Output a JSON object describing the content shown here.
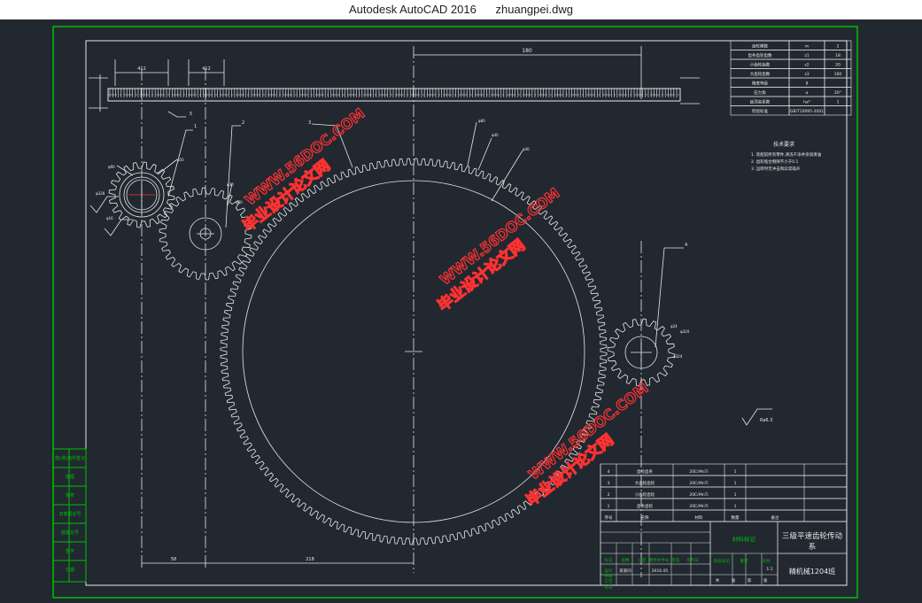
{
  "window": {
    "app": "Autodesk AutoCAD 2016",
    "file": "zhuangpei.dwg"
  },
  "colors": {
    "bg": "#212830",
    "green": "#00c000",
    "white": "#e8e8e8",
    "cyan": "#00c8d8",
    "red": "#ff3232"
  },
  "dims": {
    "top_dim": "180",
    "rack_dim_left": "412",
    "rack_dim_right": "412",
    "bottom_dim_left": "58",
    "bottom_dim_right": "218"
  },
  "gear_params": [
    {
      "name": "齿轮模数",
      "sym": "m",
      "val": "2"
    },
    {
      "name": "齿条齿轮齿数",
      "sym": "z1",
      "val": "18"
    },
    {
      "name": "小齿轮齿数",
      "sym": "z2",
      "val": "20"
    },
    {
      "name": "大齿轮齿数",
      "sym": "z3",
      "val": "160"
    },
    {
      "name": "精度等级",
      "sym": "8",
      "val": ""
    },
    {
      "name": "压力角",
      "sym": "α",
      "val": "20°"
    },
    {
      "name": "齿顶高系数",
      "sym": "ha*",
      "val": "1"
    },
    {
      "name": "检验标准",
      "sym": "GB/T10095-2001",
      "val": ""
    }
  ],
  "tech": {
    "title": "技术要求",
    "lines": [
      "1. 装配前所有零件,清洗干净并涂润滑油",
      "2. 齿轮啮合侧隙不小于0.1",
      "3. 运转时无冲击和异常噪声"
    ]
  },
  "rough": "Ra6.3",
  "leaders": [
    "1",
    "2",
    "3",
    "4",
    "5"
  ],
  "small_labels": [
    "φ90",
    "φ50",
    "φ30",
    "φ20",
    "φ80",
    "φ40",
    "φ36",
    "φ24",
    "φ320",
    "φ324",
    "φ328",
    "φ16"
  ],
  "parts": [
    {
      "no": "4",
      "name": "齿轮齿条",
      "qty": "1",
      "mat": "20CrMnTi",
      "rem": ""
    },
    {
      "no": "3",
      "name": "大齿轮齿轮",
      "qty": "1",
      "mat": "20CrMnTi",
      "rem": ""
    },
    {
      "no": "2",
      "name": "小齿轮齿轮",
      "qty": "1",
      "mat": "20CrMnTi",
      "rem": ""
    },
    {
      "no": "1",
      "name": "齿条齿轮",
      "qty": "1",
      "mat": "20CrMnTi",
      "rem": ""
    }
  ],
  "parts_header": [
    "序号",
    "名称",
    "材料",
    "数量",
    "备注"
  ],
  "title_block": {
    "stamp": "材料标记",
    "drawing_name": "三级平速齿轮传动系",
    "school": "精机械1204班",
    "scale": "1:1",
    "row_labels": [
      "设计",
      "审核",
      "工艺",
      "批准"
    ],
    "designer": "某某同",
    "date_hint": "2016.05",
    "col_labels": [
      "标记",
      "处数",
      "分区",
      "更改文件号",
      "签名",
      "年月日"
    ],
    "stage_labels": [
      "阶段标记",
      "重量",
      "比例"
    ],
    "sheet": [
      "共",
      "张",
      "第",
      "张"
    ]
  },
  "left_table": [
    "借(通)用件登记",
    "描图",
    "描校",
    "旧底图总号",
    "底图总号",
    "签字",
    "日期"
  ],
  "watermarks": [
    "毕业设计论文网",
    "WWW.56DOC.COM"
  ]
}
